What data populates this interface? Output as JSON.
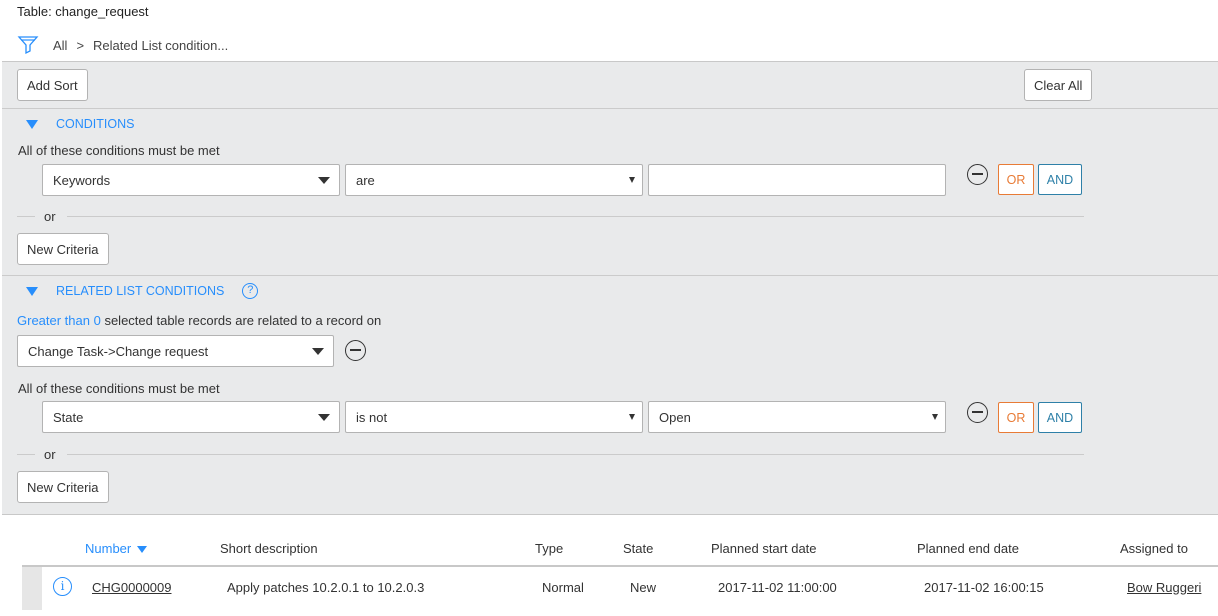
{
  "table_title": "Table: change_request",
  "breadcrumb": {
    "items": [
      "All",
      "Related List condition..."
    ],
    "separator": ">"
  },
  "toolbar": {
    "add_sort": "Add Sort",
    "clear_all": "Clear All"
  },
  "conditions": {
    "heading": "CONDITIONS",
    "requirement": "All of these conditions must be met",
    "row": {
      "field": "Keywords",
      "operator": "are",
      "value": ""
    },
    "or_label": "or",
    "and_label": "AND",
    "or_button": "OR",
    "new_criteria": "New Criteria"
  },
  "related": {
    "heading": "RELATED LIST CONDITIONS",
    "help": "?",
    "quantifier_link": "Greater than 0",
    "quantifier_text": "selected table records are related to a record on",
    "relation": "Change Task->Change request",
    "requirement": "All of these conditions must be met",
    "row": {
      "field": "State",
      "operator": "is not",
      "value": "Open"
    },
    "or_label": "or",
    "and_label": "AND",
    "or_button": "OR",
    "new_criteria": "New Criteria"
  },
  "list": {
    "columns": [
      "Number",
      "Short description",
      "Type",
      "State",
      "Planned start date",
      "Planned end date",
      "Assigned to"
    ],
    "sorted_column": "Number",
    "sort_direction": "descending",
    "rows": [
      {
        "number": "CHG0000009",
        "short_description": "Apply patches 10.2.0.1 to 10.2.0.3",
        "type": "Normal",
        "state": "New",
        "planned_start": "2017-11-02 11:00:00",
        "planned_end": "2017-11-02 16:00:15",
        "assigned_to": "Bow Ruggeri"
      }
    ]
  },
  "colors": {
    "accent": "#278efc",
    "or_button": "#e87b36",
    "and_button": "#2e80a8",
    "panel_bg": "#e9eaeb"
  },
  "icons": {
    "filter": "filter-funnel-icon",
    "remove": "minus-circle-icon",
    "info": "info-icon",
    "help": "help-icon"
  }
}
